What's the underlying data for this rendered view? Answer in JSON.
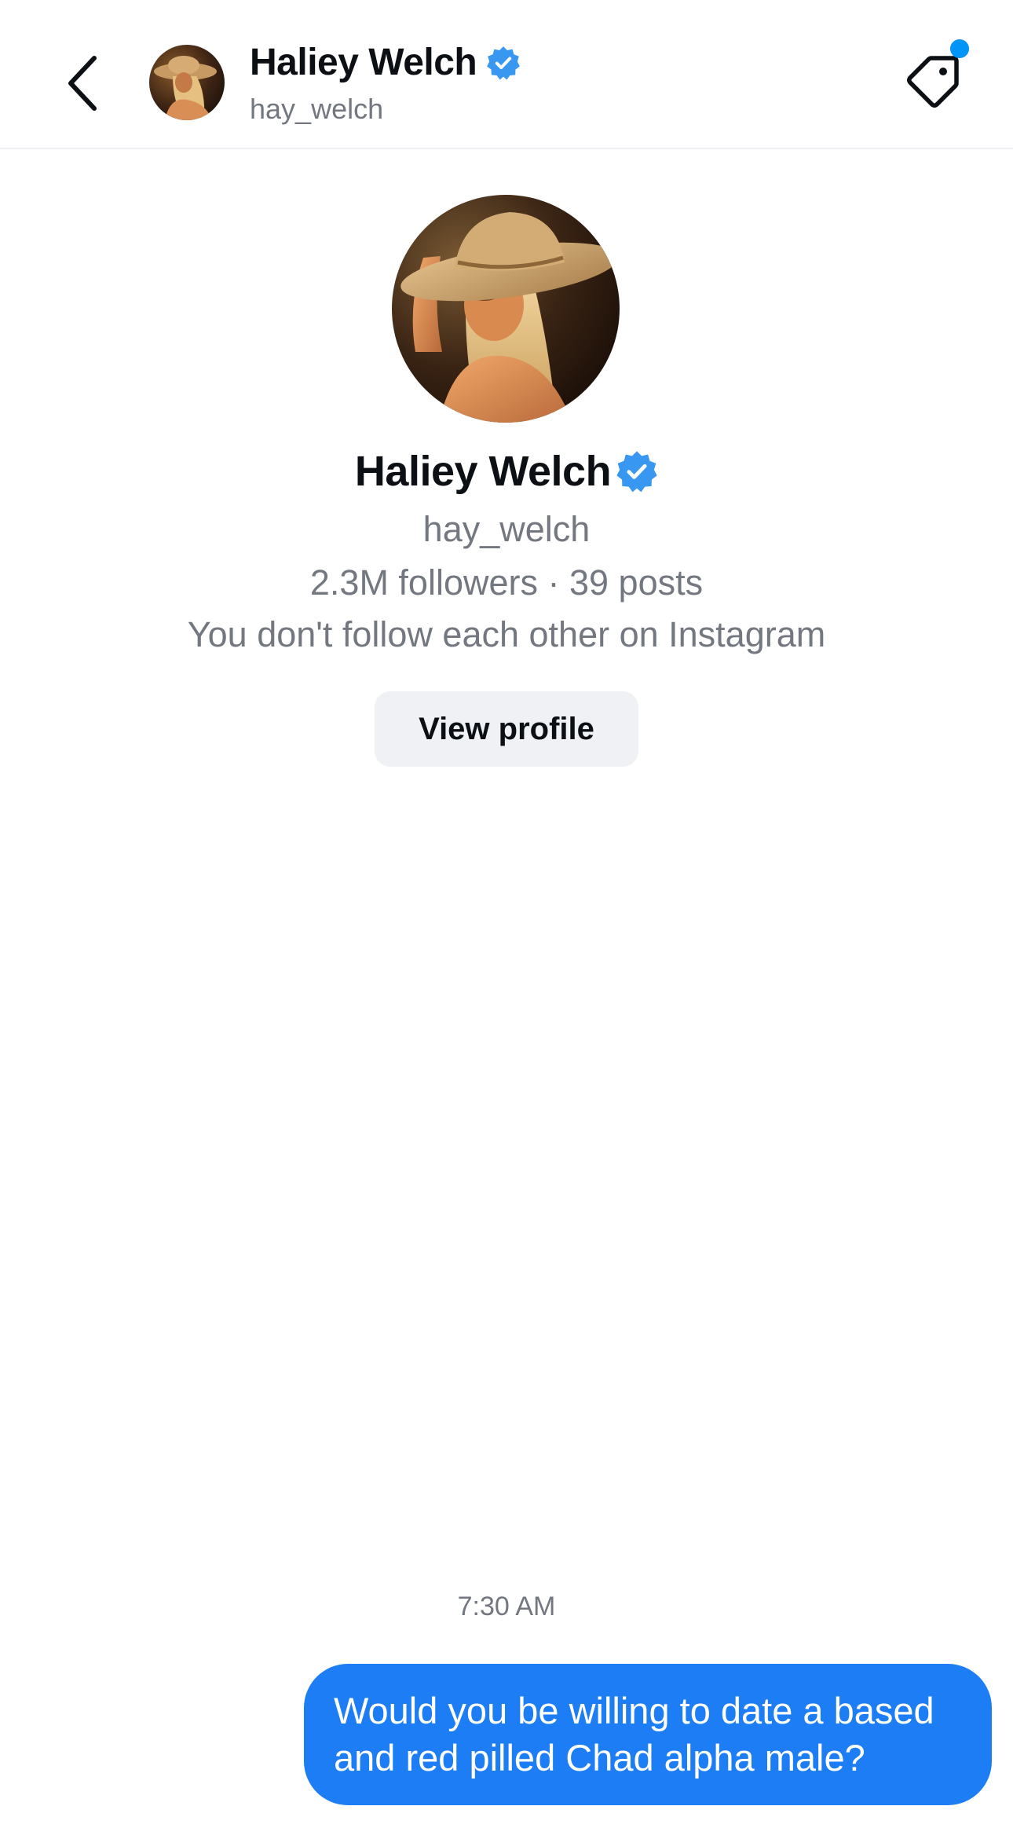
{
  "header": {
    "display_name": "Haliey Welch",
    "username": "hay_welch",
    "icons": {
      "back": "chevron-left-icon",
      "verified": "verified-badge-icon",
      "tag": "tag-icon"
    },
    "notification_dot_color": "#0095f6"
  },
  "profile": {
    "display_name": "Haliey Welch",
    "username": "hay_welch",
    "stats": "2.3M followers · 39 posts",
    "follow_status": "You don't follow each other on Instagram",
    "view_profile_label": "View profile"
  },
  "conversation": {
    "timestamp": "7:30 AM",
    "messages": [
      {
        "sender": "me",
        "text": "Would you be willing to date a based and red pilled Chad alpha male?",
        "bubble_color": "#1d7df5"
      }
    ]
  },
  "colors": {
    "accent_blue": "#1d7df5",
    "verified_blue": "#3897f0",
    "secondary_text": "#737780"
  }
}
